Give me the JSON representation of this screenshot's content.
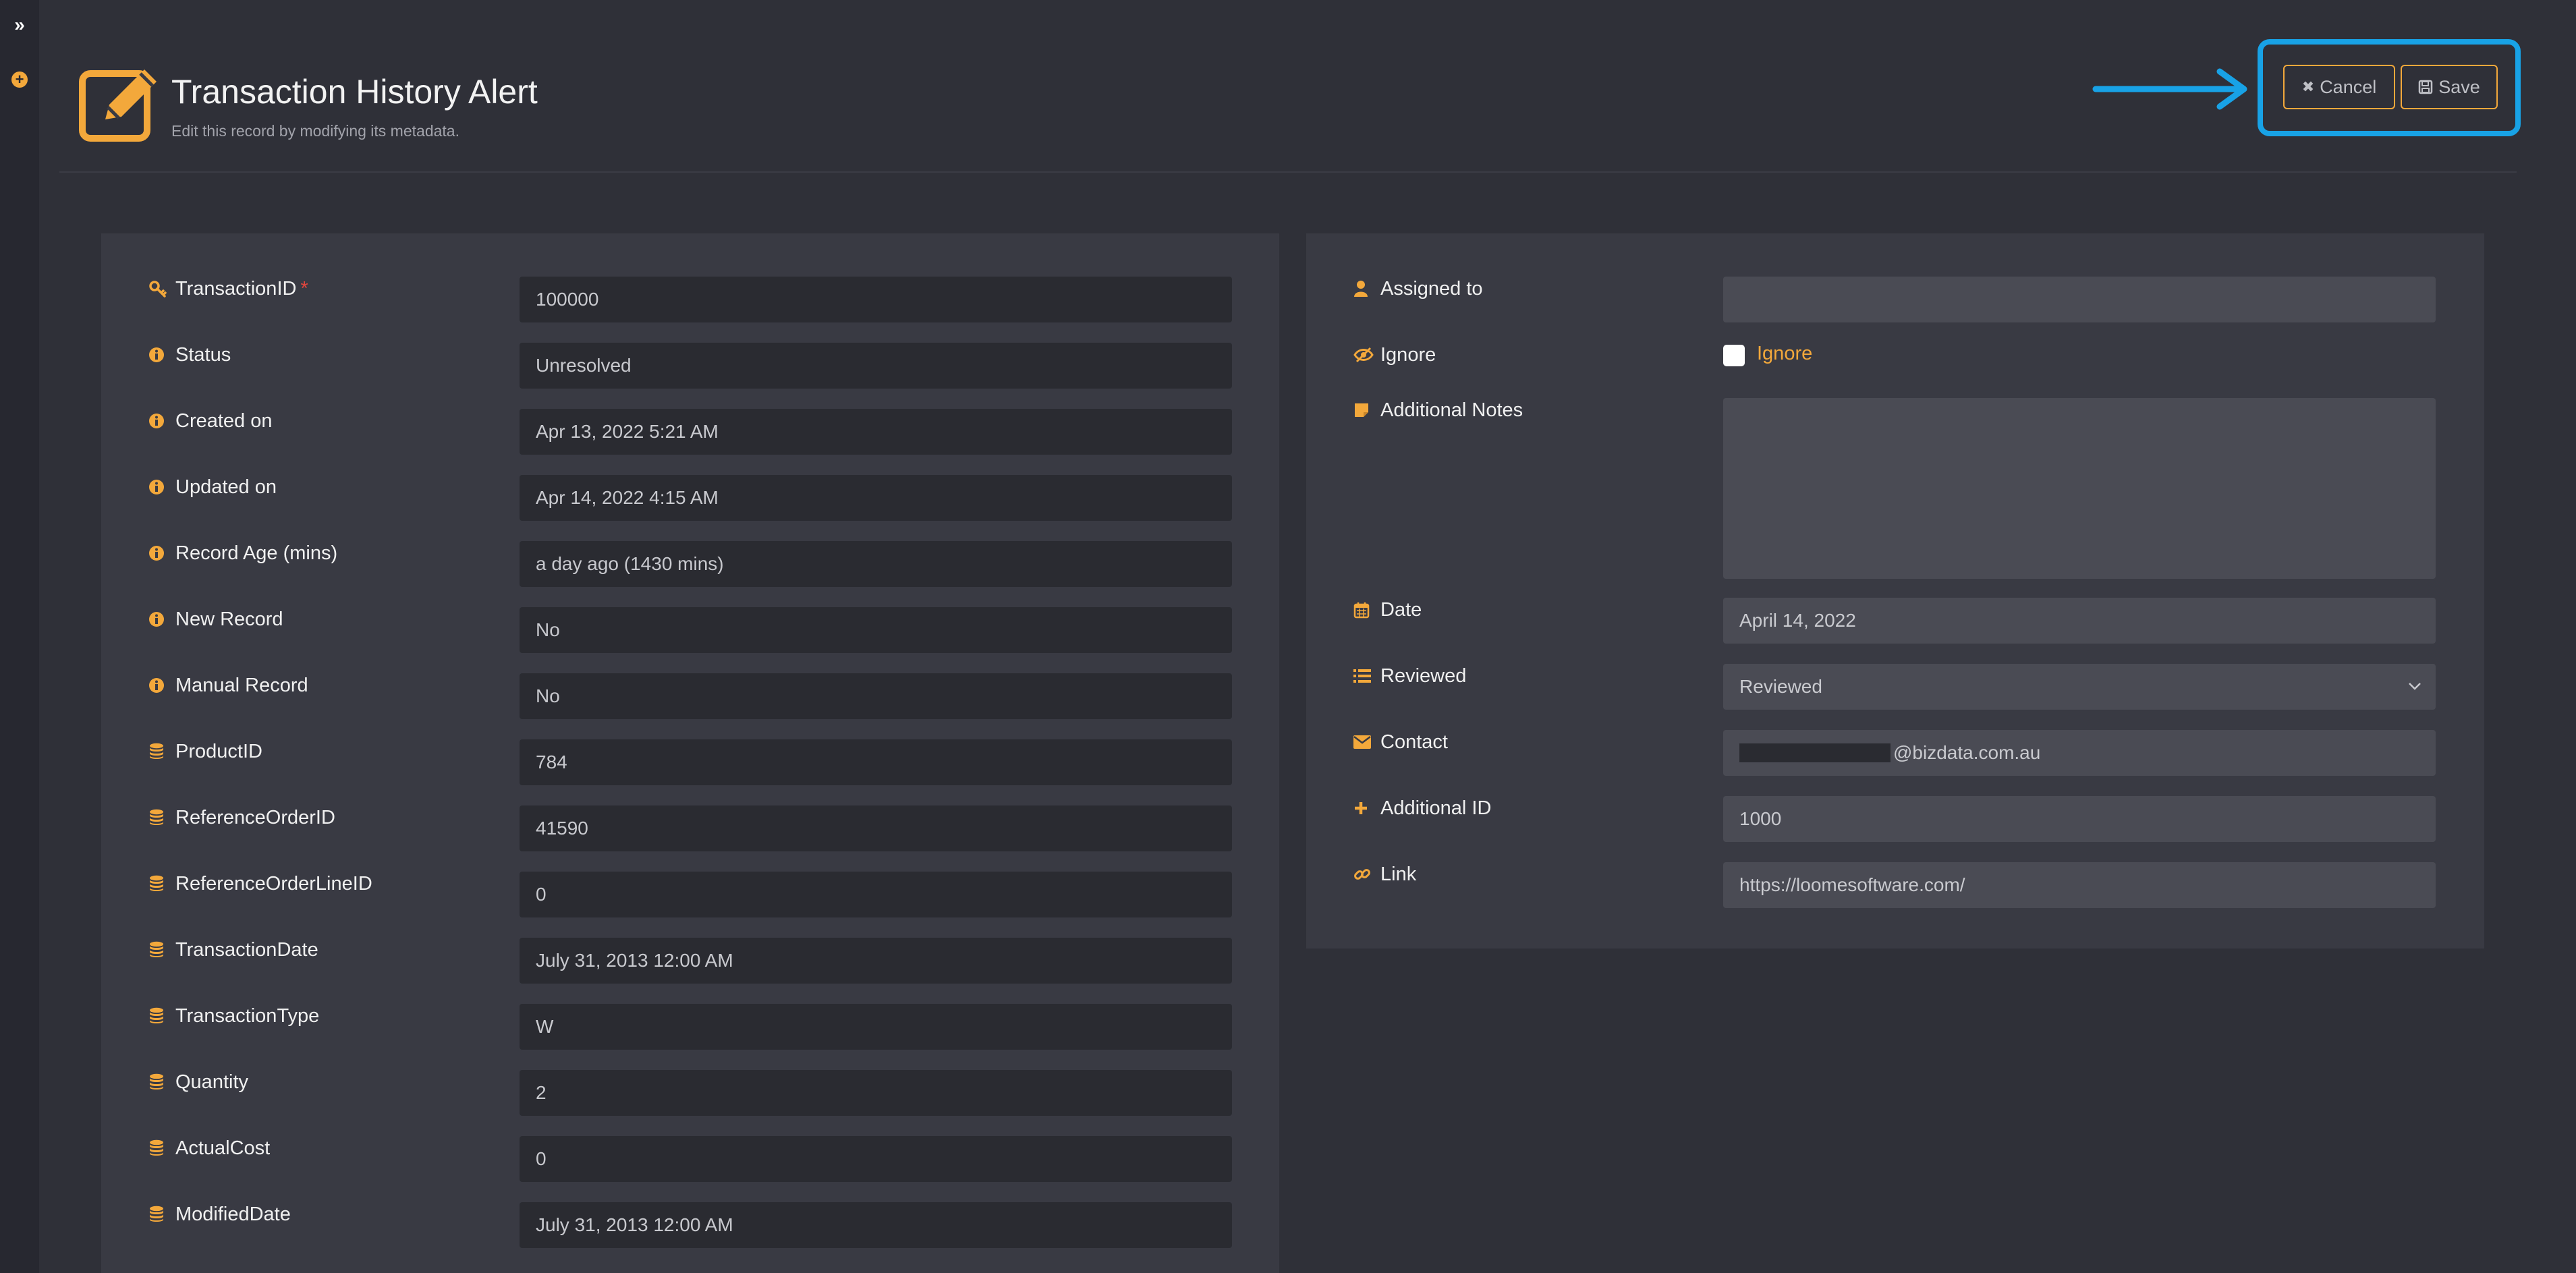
{
  "sidebar": {
    "expand_icon": "double-chevron-right-icon",
    "add_icon": "plus-circle-icon"
  },
  "header": {
    "title": "Transaction History Alert",
    "subtitle": "Edit this record by modifying its metadata.",
    "icon": "edit-pencil-icon",
    "cancel_label": "Cancel",
    "save_label": "Save",
    "accent_color": "#f3a83b",
    "highlight_color": "#18a2e6"
  },
  "left_fields": [
    {
      "label": "TransactionID",
      "value": "100000",
      "icon": "key-icon",
      "required": "*"
    },
    {
      "label": "Status",
      "value": "Unresolved",
      "icon": "info-icon"
    },
    {
      "label": "Created on",
      "value": "Apr 13, 2022 5:21 AM",
      "icon": "info-icon"
    },
    {
      "label": "Updated on",
      "value": "Apr 14, 2022 4:15 AM",
      "icon": "info-icon"
    },
    {
      "label": "Record Age (mins)",
      "value": "a day ago (1430 mins)",
      "icon": "info-icon"
    },
    {
      "label": "New Record",
      "value": "No",
      "icon": "info-icon"
    },
    {
      "label": "Manual Record",
      "value": "No",
      "icon": "info-icon"
    },
    {
      "label": "ProductID",
      "value": "784",
      "icon": "database-icon"
    },
    {
      "label": "ReferenceOrderID",
      "value": "41590",
      "icon": "database-icon"
    },
    {
      "label": "ReferenceOrderLineID",
      "value": "0",
      "icon": "database-icon"
    },
    {
      "label": "TransactionDate",
      "value": "July 31, 2013 12:00 AM",
      "icon": "database-icon"
    },
    {
      "label": "TransactionType",
      "value": "W",
      "icon": "database-icon"
    },
    {
      "label": "Quantity",
      "value": "2",
      "icon": "database-icon"
    },
    {
      "label": "ActualCost",
      "value": "0",
      "icon": "database-icon"
    },
    {
      "label": "ModifiedDate",
      "value": "July 31, 2013 12:00 AM",
      "icon": "database-icon"
    }
  ],
  "right": {
    "assigned_to": {
      "label": "Assigned to",
      "value": "",
      "icon": "user-icon"
    },
    "ignore": {
      "label": "Ignore",
      "checkbox_label": "Ignore",
      "checked": false,
      "icon": "eye-slash-icon"
    },
    "notes": {
      "label": "Additional Notes",
      "value": "",
      "icon": "sticky-note-icon"
    },
    "date": {
      "label": "Date",
      "value": "April 14, 2022",
      "icon": "calendar-icon"
    },
    "reviewed": {
      "label": "Reviewed",
      "value": "Reviewed",
      "icon": "list-icon"
    },
    "contact": {
      "label": "Contact",
      "value": "@bizdata.com.au",
      "icon": "envelope-icon"
    },
    "additional_id": {
      "label": "Additional ID",
      "value": "1000",
      "icon": "plus-icon"
    },
    "link": {
      "label": "Link",
      "value": "https://loomesoftware.com/",
      "icon": "link-icon"
    }
  }
}
